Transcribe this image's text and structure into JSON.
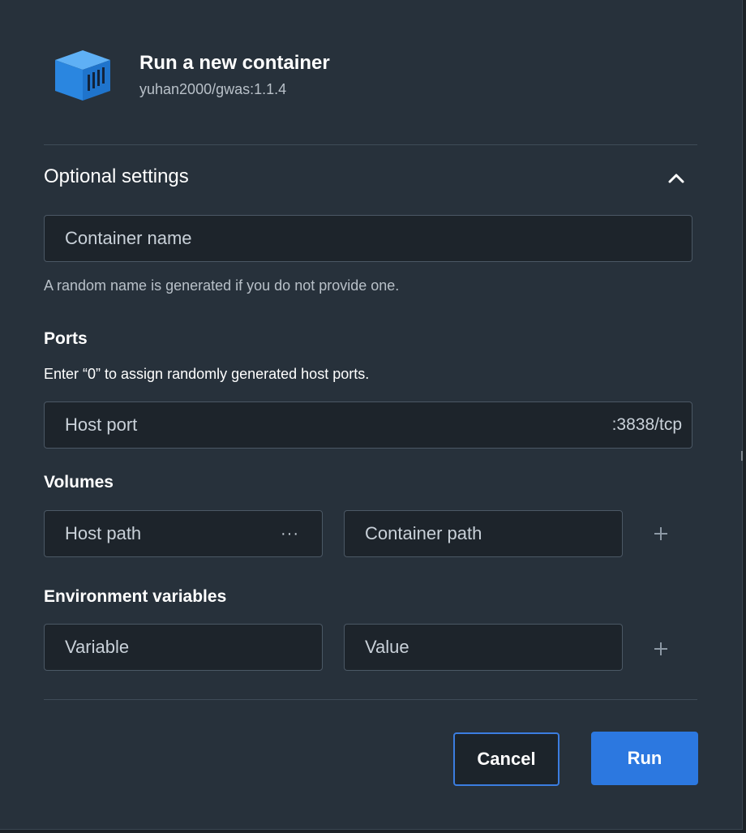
{
  "dialog": {
    "title": "Run a new container",
    "image": "yuhan2000/gwas:1.1.4",
    "logo_icon": "container-icon"
  },
  "optional": {
    "title": "Optional settings",
    "toggle_icon": "chevron-up-icon"
  },
  "container_name": {
    "placeholder": "Container name",
    "value": "",
    "helper": "A random name is generated if you do not provide one."
  },
  "ports": {
    "label": "Ports",
    "description": "Enter “0” to assign randomly generated host ports.",
    "host_port_placeholder": "Host port",
    "suffix": ":3838/tcp"
  },
  "volumes": {
    "label": "Volumes",
    "host_path_placeholder": "Host path",
    "browse_label": "···",
    "container_path_placeholder": "Container path",
    "add_icon": "plus-icon"
  },
  "env": {
    "label": "Environment variables",
    "variable_placeholder": "Variable",
    "value_placeholder": "Value",
    "add_icon": "plus-icon"
  },
  "actions": {
    "cancel": "Cancel",
    "run": "Run"
  },
  "colors": {
    "background": "#27313b",
    "field": "#1d242b",
    "accent": "#2c78e0",
    "logo": "#2e8fe8"
  }
}
